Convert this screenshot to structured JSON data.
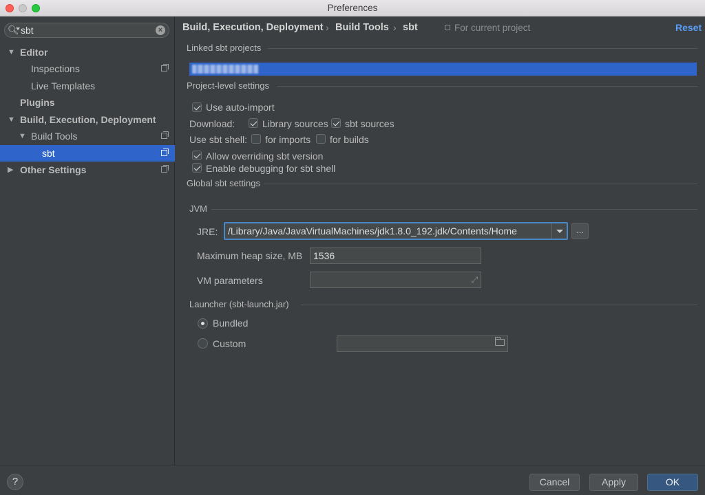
{
  "window": {
    "title": "Preferences"
  },
  "search": {
    "value": "sbt",
    "placeholder": ""
  },
  "sidebar": {
    "items": [
      {
        "label": "Editor"
      },
      {
        "label": "Inspections"
      },
      {
        "label": "Live Templates"
      },
      {
        "label": "Plugins"
      },
      {
        "label": "Build, Execution, Deployment"
      },
      {
        "label": "Build Tools"
      },
      {
        "label": "sbt"
      },
      {
        "label": "Other Settings"
      }
    ]
  },
  "breadcrumb": {
    "items": [
      "Build, Execution, Deployment",
      "Build Tools",
      "sbt"
    ],
    "separator": "›",
    "scope": "For current project"
  },
  "reset_label": "Reset",
  "linked": {
    "heading": "Linked sbt projects"
  },
  "project_level": {
    "heading": "Project-level settings",
    "use_auto_import": "Use auto-import",
    "download_label": "Download:",
    "library_sources": "Library sources",
    "sbt_sources": "sbt sources",
    "use_sbt_shell": "Use sbt shell:",
    "for_imports": "for imports",
    "for_builds": "for builds",
    "allow_overriding": "Allow overriding sbt version",
    "enable_debugging": "Enable debugging for sbt shell"
  },
  "global": {
    "heading": "Global sbt settings",
    "jvm_heading": "JVM",
    "jre_label": "JRE:",
    "jre_value": "/Library/Java/JavaVirtualMachines/jdk1.8.0_192.jdk/Contents/Home",
    "browse_label": "...",
    "heap_label": "Maximum heap size, MB",
    "heap_value": "1536",
    "vm_label": "VM parameters",
    "vm_value": "",
    "launcher_heading": "Launcher (sbt-launch.jar)",
    "bundled_label": "Bundled",
    "custom_label": "Custom",
    "custom_path": ""
  },
  "footer": {
    "help_label": "?",
    "cancel_label": "Cancel",
    "apply_label": "Apply",
    "ok_label": "OK"
  },
  "colors": {
    "selection": "#2f65ca",
    "accent_link": "#589df6",
    "background": "#3c3f41"
  }
}
